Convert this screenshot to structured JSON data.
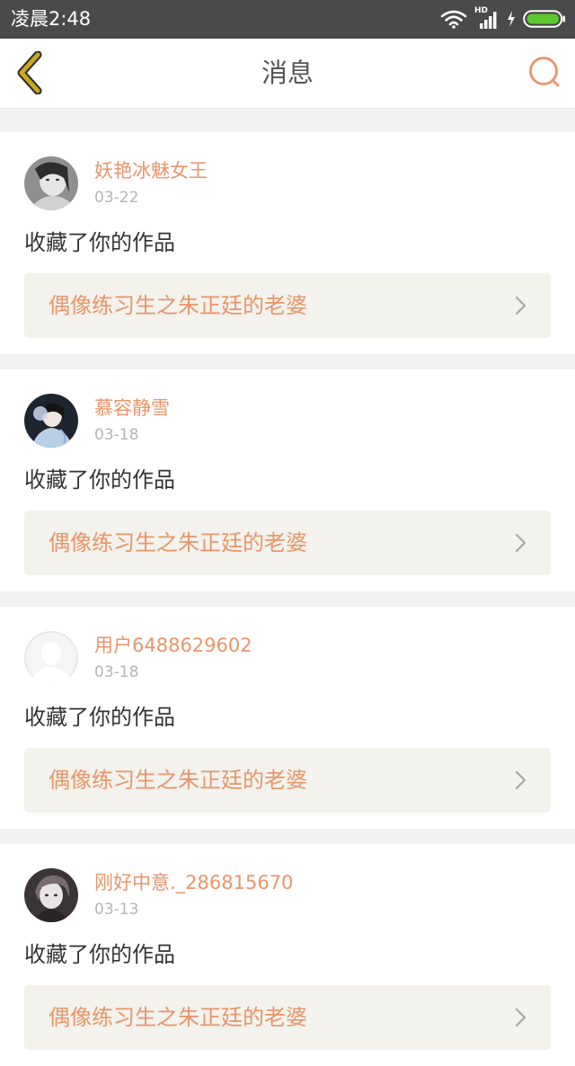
{
  "status_bar": {
    "time": "凌晨2:48",
    "signal_label": "HD",
    "icons": [
      "wifi-icon",
      "signal-icon",
      "charging-icon",
      "battery-icon"
    ]
  },
  "header": {
    "title": "消息",
    "back_icon": "chevron-left-icon",
    "search_icon": "search-icon"
  },
  "colors": {
    "accent": "#e8956a",
    "back_icon": "#c9a81e",
    "status_bar_bg": "#4a4a4a",
    "card_link_bg": "#f3f2ec",
    "battery": "#5ec831"
  },
  "messages": [
    {
      "username": "妖艳冰魅女王",
      "date": "03-22",
      "action": "收藏了你的作品",
      "work_title": "偶像练习生之朱正廷的老婆",
      "avatar": "photo-avatar"
    },
    {
      "username": "慕容静雪",
      "date": "03-18",
      "action": "收藏了你的作品",
      "work_title": "偶像练习生之朱正廷的老婆",
      "avatar": "photo-avatar"
    },
    {
      "username": "用户6488629602",
      "date": "03-18",
      "action": "收藏了你的作品",
      "work_title": "偶像练习生之朱正廷的老婆",
      "avatar": "default-avatar"
    },
    {
      "username": "刚好中意._286815670",
      "date": "03-13",
      "action": "收藏了你的作品",
      "work_title": "偶像练习生之朱正廷的老婆",
      "avatar": "photo-avatar"
    }
  ]
}
